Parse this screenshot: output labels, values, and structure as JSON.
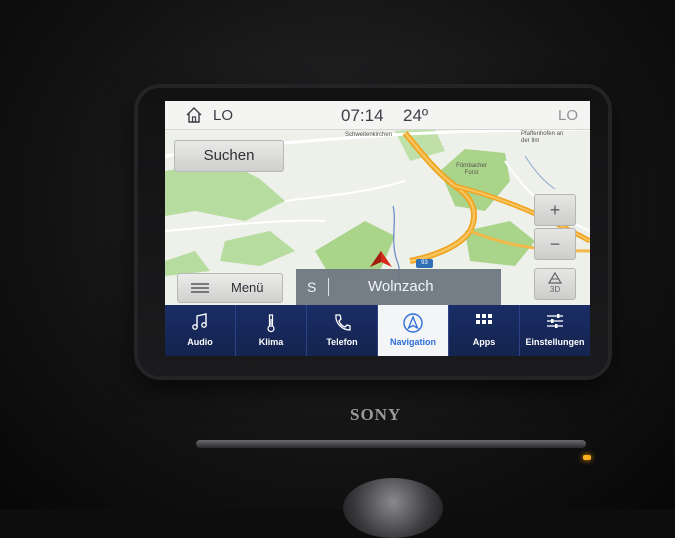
{
  "status": {
    "left_label": "LO",
    "time": "07:14",
    "temperature": "24º",
    "right_label": "LO"
  },
  "map": {
    "labels": [
      "Schweitenkirchen",
      "Pfaffenhofen an der Ilm",
      "Förnbacher Forst"
    ],
    "road_number": "93",
    "search_label": "Suchen",
    "zoom_in": "+",
    "zoom_out": "−",
    "view_mode": "3D",
    "menu_label": "Menü",
    "direction_letter": "S",
    "destination": "Wolnzach"
  },
  "nav": {
    "items": [
      {
        "label": "Audio",
        "icon": "music-note-icon"
      },
      {
        "label": "Klima",
        "icon": "thermometer-icon"
      },
      {
        "label": "Telefon",
        "icon": "phone-icon"
      },
      {
        "label": "Navigation",
        "icon": "navigation-arrow-icon"
      },
      {
        "label": "Apps",
        "icon": "apps-grid-icon"
      },
      {
        "label": "Einstellungen",
        "icon": "sliders-icon"
      }
    ],
    "active_index": 3
  },
  "hardware": {
    "brand": "SONY"
  },
  "colors": {
    "navbar": "#1a2d66",
    "active_tab_text": "#2f6fd6",
    "route_bar": "#707a84",
    "road_orange": "#f0a420",
    "forest_green": "#a9d48a"
  }
}
